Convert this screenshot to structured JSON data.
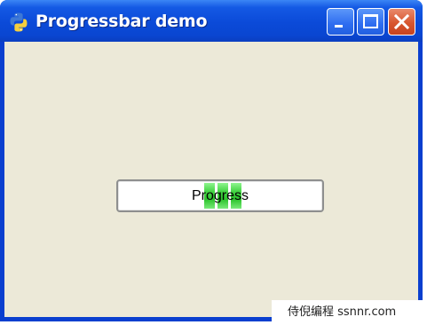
{
  "window": {
    "title": "Progressbar demo",
    "icon": "python-icon",
    "buttons": [
      "minimize",
      "maximize",
      "close"
    ]
  },
  "progressbar": {
    "text": "Progress",
    "value_percent": 16,
    "fill_start_percent": 42,
    "chunk_count": 3,
    "fill_color": "#2ec42e"
  },
  "watermark": {
    "text": "侍倪编程 ssnnr.com"
  },
  "colors": {
    "titlebar": "#0a46d1",
    "client_bg": "#ece9d8",
    "close_button": "#d8562f"
  }
}
